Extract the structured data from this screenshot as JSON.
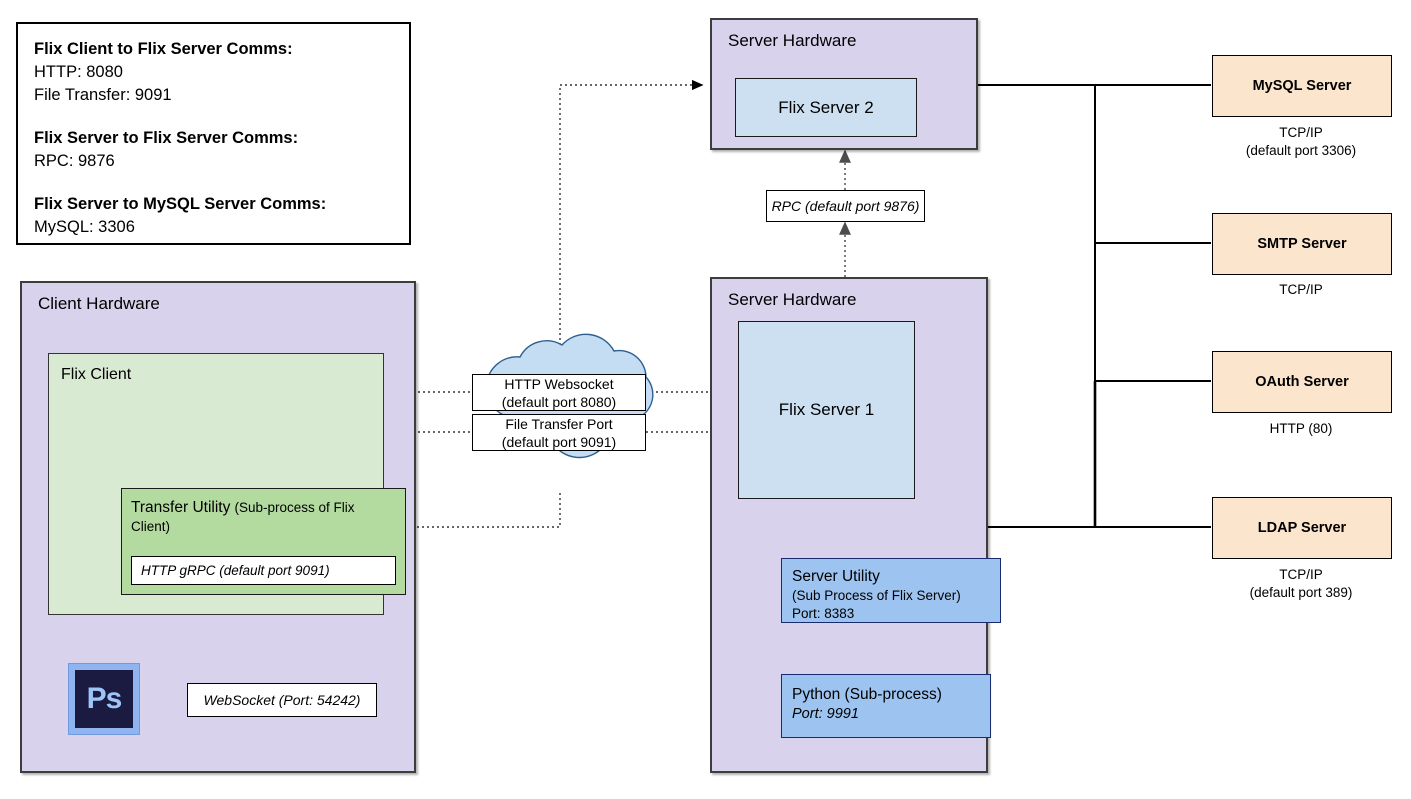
{
  "legend": {
    "groups": [
      {
        "heading": "Flix Client to Flix Server Comms:",
        "lines": [
          "HTTP: 8080",
          "File Transfer: 9091"
        ]
      },
      {
        "heading": "Flix Server to Flix Server Comms:",
        "lines": [
          "RPC: 9876"
        ]
      },
      {
        "heading": "Flix Server to MySQL Server Comms:",
        "lines": [
          "MySQL: 3306"
        ]
      }
    ]
  },
  "client_hardware": {
    "title": "Client Hardware",
    "flix_client": {
      "title": "Flix Client",
      "transfer_utility": {
        "title": "Transfer Utility",
        "subtitle": "(Sub-process of Flix Client)",
        "port_label": "HTTP gRPC (default port 9091)"
      }
    },
    "photoshop": {
      "icon_label": "Ps"
    },
    "websocket_label": "WebSocket (Port: 54242)"
  },
  "server_hardware_top": {
    "title": "Server Hardware",
    "server_name": "Flix Server 2"
  },
  "server_hardware_main": {
    "title": "Server Hardware",
    "server_name": "Flix Server 1",
    "server_utility": {
      "title": "Server Utility",
      "subtitle": "(Sub Process of Flix Server)",
      "port": "Port: 8383"
    },
    "python": {
      "title": "Python (Sub-process)",
      "port": "Port: 9991"
    }
  },
  "rpc_label": "RPC (default port 9876)",
  "cloud": {
    "http_websocket": {
      "line1": "HTTP Websocket",
      "line2": "(default port 8080)"
    },
    "file_transfer": {
      "line1": "File Transfer Port",
      "line2": "(default port 9091)"
    }
  },
  "external_servers": [
    {
      "name": "MySQL Server",
      "caption_line1": "TCP/IP",
      "caption_line2": "(default port 3306)"
    },
    {
      "name": "SMTP Server",
      "caption_line1": "TCP/IP",
      "caption_line2": ""
    },
    {
      "name": "OAuth Server",
      "caption_line1": "HTTP (80)",
      "caption_line2": ""
    },
    {
      "name": "LDAP Server",
      "caption_line1": "TCP/IP",
      "caption_line2": "(default port 389)"
    }
  ],
  "colors": {
    "hardware_purple": "#d9d2ec",
    "flix_client_green": "#d9ead3",
    "transfer_utility_green": "#b3dba0",
    "flix_server_blue": "#cce0f2",
    "subprocess_blue": "#9dc3f0",
    "external_peach": "#fbe5cd",
    "cloud_blue": "#c5ddf2",
    "photoshop_navy": "#1b1b41",
    "photoshop_text": "#9fc5f8"
  }
}
